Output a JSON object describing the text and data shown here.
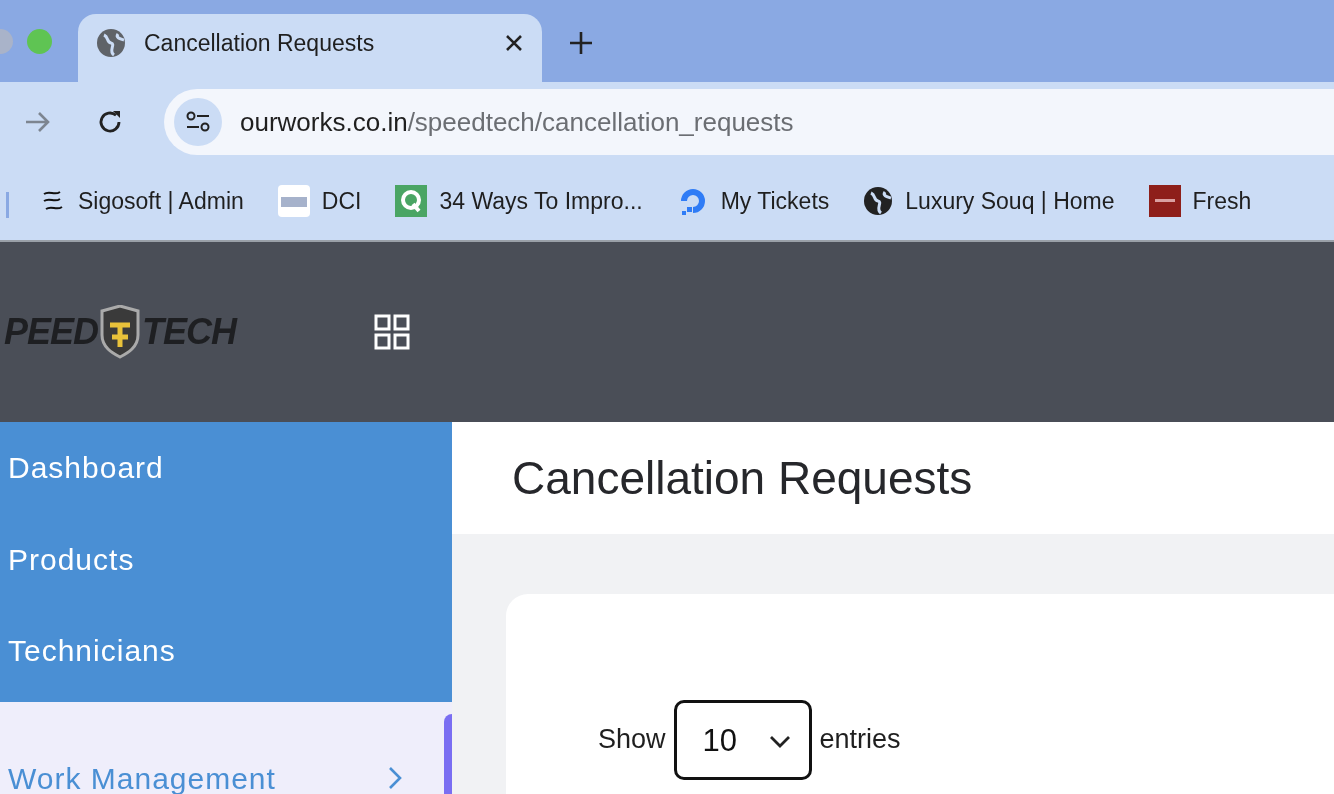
{
  "browser": {
    "tab": {
      "title": "Cancellation Requests",
      "selected": true
    },
    "address": {
      "host": "ourworks.co.in",
      "path": "/speedtech/cancellation_requests"
    },
    "bookmarks": [
      {
        "label": "Sigosoft | Admin",
        "kind": "wave"
      },
      {
        "label": "DCI",
        "kind": "dci"
      },
      {
        "label": "34 Ways To Impro...",
        "kind": "q"
      },
      {
        "label": "My Tickets",
        "kind": "ring"
      },
      {
        "label": "Luxury Souq | Home",
        "kind": "globe"
      },
      {
        "label": "Fresh",
        "kind": "red"
      }
    ]
  },
  "header": {
    "logo": [
      "PEED",
      "TECH"
    ]
  },
  "sidebar": {
    "items": [
      {
        "label": "Dashboard",
        "selected": false,
        "expandable": false
      },
      {
        "label": "Products",
        "selected": false,
        "expandable": false
      },
      {
        "label": "Technicians",
        "selected": false,
        "expandable": false
      },
      {
        "label": "Work Management",
        "selected": true,
        "expandable": true
      }
    ]
  },
  "page": {
    "title": "Cancellation Requests",
    "length": {
      "before": "Show",
      "value": "10",
      "after": "entries"
    }
  }
}
